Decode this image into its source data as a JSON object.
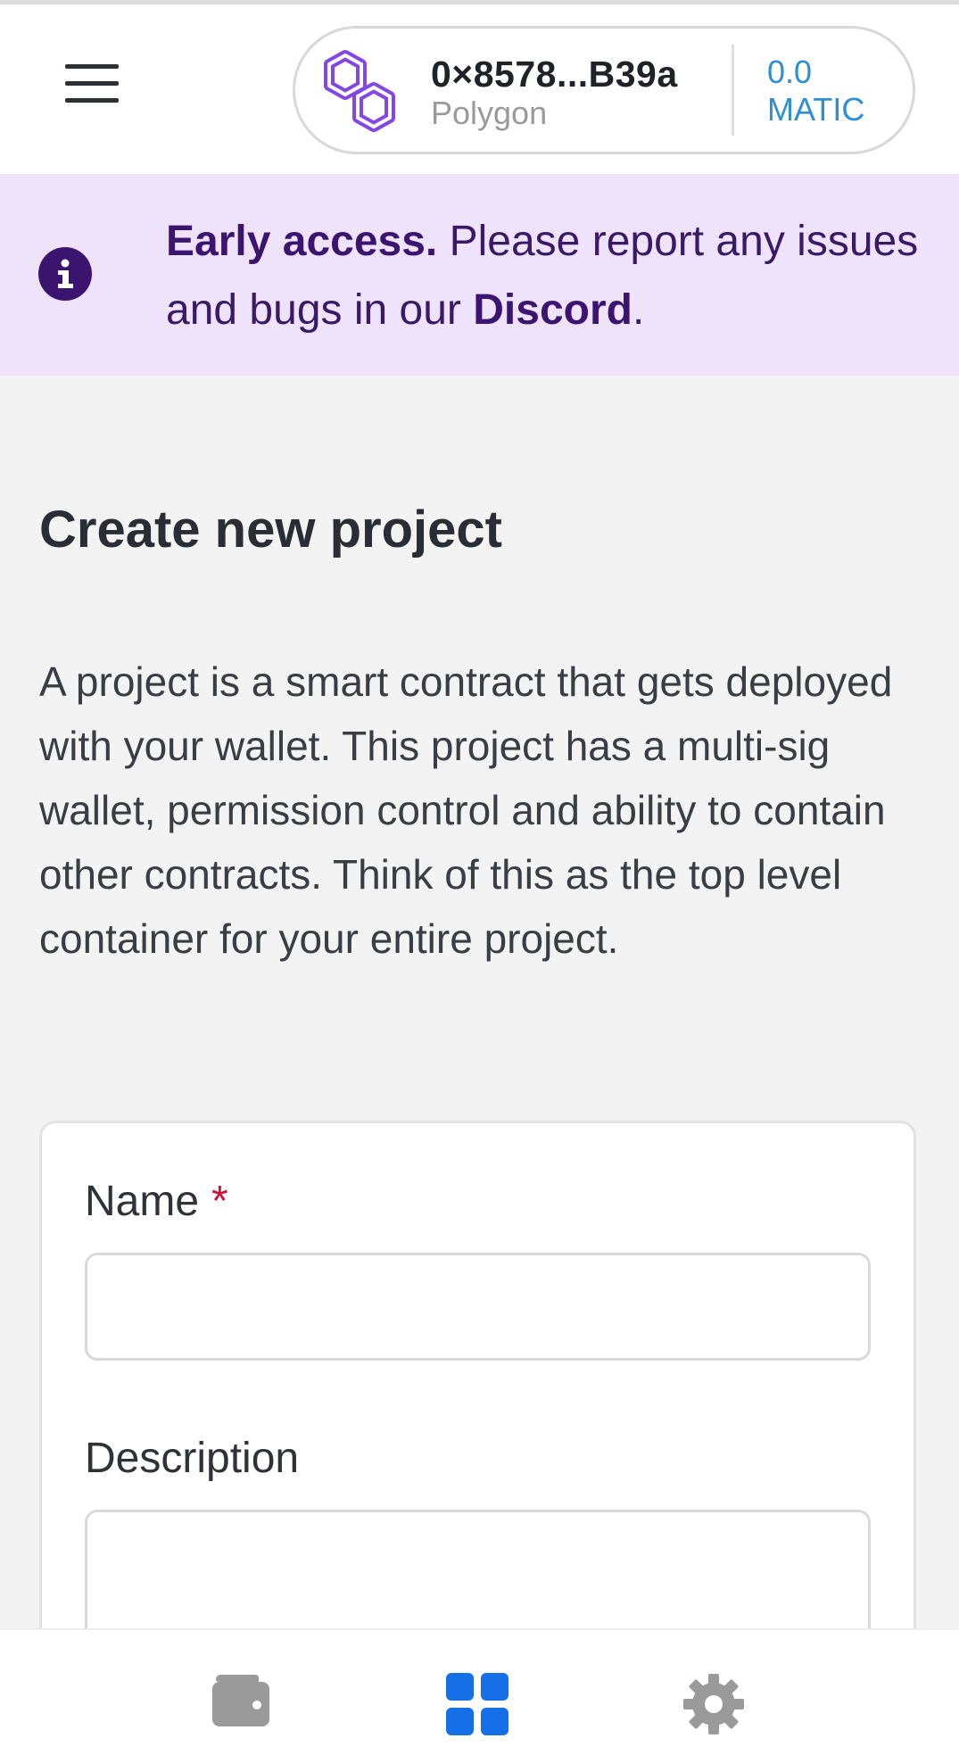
{
  "header": {
    "wallet": {
      "address": "0×8578...B39a",
      "network": "Polygon",
      "balance_amount": "0.0",
      "balance_unit": "MATIC"
    }
  },
  "banner": {
    "bold_prefix": "Early access.",
    "text": " Please report any issues and bugs in our ",
    "link_label": "Discord",
    "suffix": "."
  },
  "page": {
    "title": "Create new project",
    "description": "A project is a smart contract that gets deployed with your wallet. This project has a multi-sig wallet, permission control and ability to contain other contracts. Think of this as the top level container for your entire project."
  },
  "form": {
    "name_label": "Name",
    "required_marker": "*",
    "name_value": "",
    "description_label": "Description",
    "description_value": ""
  },
  "bottom_nav": {
    "items": [
      {
        "icon": "wallet-icon",
        "active": false
      },
      {
        "icon": "grid-icon",
        "active": true
      },
      {
        "icon": "gear-icon",
        "active": false
      }
    ]
  },
  "colors": {
    "accent_blue": "#1570e8",
    "polygon_purple": "#8247e5",
    "banner_bg": "#efe3fb",
    "required_red": "#d0103a",
    "balance_blue": "#2f8fd0"
  }
}
